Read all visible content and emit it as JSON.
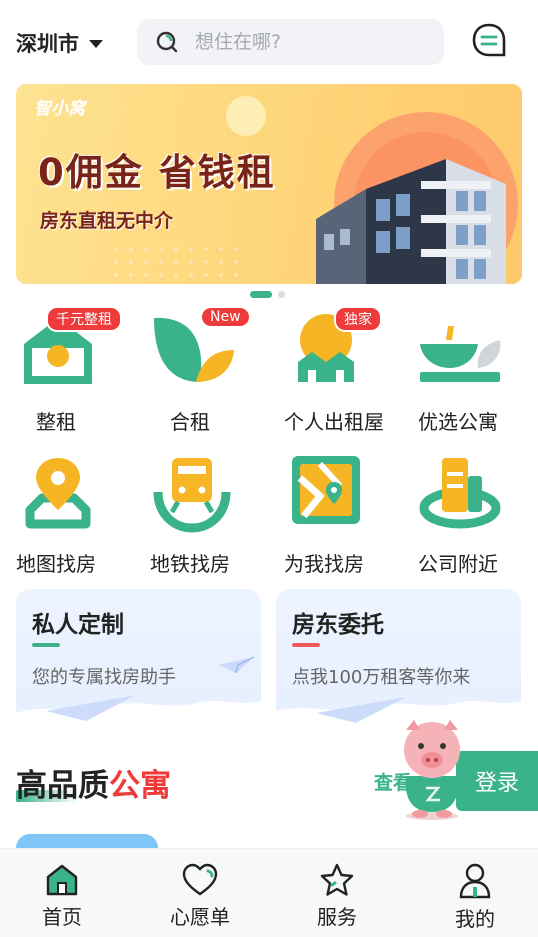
{
  "header": {
    "city": "深圳市",
    "search_placeholder": "想住在哪?"
  },
  "banner": {
    "brand": "智小窝",
    "headline": "0佣金 省钱租",
    "subline": "房东直租无中介",
    "page_count": 2,
    "active_page": 1
  },
  "categories": [
    {
      "label": "整租",
      "badge": "千元整租",
      "icon": "house-icon"
    },
    {
      "label": "合租",
      "badge": "New",
      "icon": "leaf-icon"
    },
    {
      "label": "个人出租屋",
      "badge": "独家",
      "icon": "sunrise-house-icon"
    },
    {
      "label": "优选公寓",
      "badge": "",
      "icon": "bowl-icon"
    },
    {
      "label": "地图找房",
      "badge": "",
      "icon": "map-pin-icon"
    },
    {
      "label": "地铁找房",
      "badge": "",
      "icon": "subway-icon"
    },
    {
      "label": "为我找房",
      "badge": "",
      "icon": "map-route-icon"
    },
    {
      "label": "公司附近",
      "badge": "",
      "icon": "office-building-icon"
    }
  ],
  "cards": [
    {
      "title": "私人定制",
      "subtitle": "您的专属找房助手",
      "accent": "#3ab38a"
    },
    {
      "title": "房东委托",
      "subtitle": "点我100万租客等你来",
      "accent": "#ee5a5a"
    }
  ],
  "section": {
    "title_main": "高品质",
    "title_accent": "公寓",
    "view_all": "查看"
  },
  "login_label": "登录",
  "tabs": [
    {
      "label": "首页",
      "icon": "home-icon",
      "active": true
    },
    {
      "label": "心愿单",
      "icon": "heart-icon",
      "active": false
    },
    {
      "label": "服务",
      "icon": "star-icon",
      "active": false
    },
    {
      "label": "我的",
      "icon": "user-icon",
      "active": false
    }
  ],
  "colors": {
    "brand_green": "#3ab38a",
    "badge_red": "#ee3a3a",
    "accent_red": "#ee3a3a",
    "banner_text": "#7a2418"
  }
}
